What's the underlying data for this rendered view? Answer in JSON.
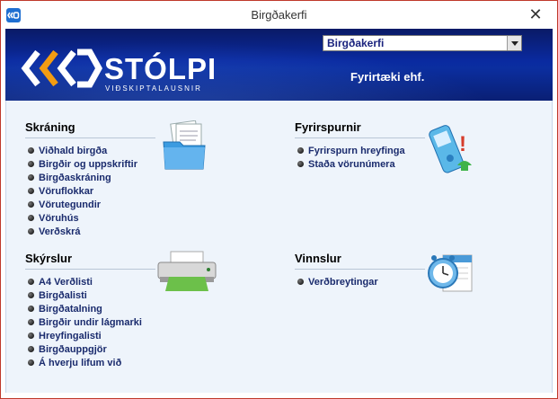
{
  "window": {
    "title": "Birgðakerfi",
    "close_glyph": "✕"
  },
  "banner": {
    "brand": "STÓLPI",
    "tagline": "VIÐSKIPTALAUSNIR",
    "dropdown_value": "Birgðakerfi",
    "company": "Fyrirtæki ehf."
  },
  "sections": {
    "skraning": {
      "title": "Skráning",
      "icon": "documents-folder-icon",
      "items": [
        "Viðhald birgða",
        "Birgðir og uppskriftir",
        "Birgðaskráning",
        "Vöruflokkar",
        "Vörutegundir",
        "Vöruhús",
        "Verðskrá"
      ]
    },
    "fyrirspurnir": {
      "title": "Fyrirspurnir",
      "icon": "phone-question-icon",
      "items": [
        "Fyrirspurn hreyfinga",
        "Staða vörunúmera"
      ]
    },
    "skyrslur": {
      "title": "Skýrslur",
      "icon": "printer-icon",
      "items": [
        "A4 Verðlisti",
        "Birgðalisti",
        "Birgðatalning",
        "Birgðir undir lágmarki",
        "Hreyfingalisti",
        "Birgðauppgjör",
        "Á hverju lifum við"
      ]
    },
    "vinnslur": {
      "title": "Vinnslur",
      "icon": "clock-calendar-icon",
      "items": [
        "Verðbreytingar"
      ]
    }
  },
  "colors": {
    "banner": "#0a2aa0",
    "link": "#1a2b6d",
    "content_bg": "#eef4fb",
    "logo_orange": "#f39c12"
  }
}
